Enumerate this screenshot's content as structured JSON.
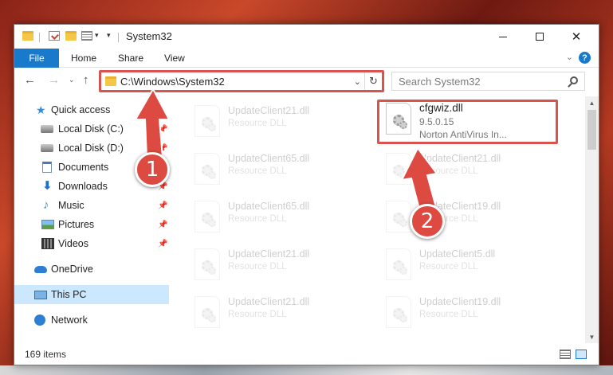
{
  "window": {
    "title": "System32",
    "controls": {
      "minimize": "",
      "maximize": "",
      "close": "✕"
    }
  },
  "ribbon": {
    "file_tab": "File",
    "tabs": [
      "Home",
      "Share",
      "View"
    ],
    "expand_glyph": "⌄",
    "help_glyph": "?"
  },
  "nav": {
    "back": "←",
    "forward": "→",
    "recent": "⌄",
    "up": "↑",
    "address": "C:\\Windows\\System32",
    "address_dropdown": "⌄",
    "refresh": "↻",
    "search_placeholder": "Search System32"
  },
  "sidebar": {
    "items": [
      {
        "label": "Quick access",
        "icon": "star-icon"
      },
      {
        "label": "Local Disk (C:)",
        "icon": "disk-icon",
        "pinned": true
      },
      {
        "label": "Local Disk (D:)",
        "icon": "disk-icon",
        "pinned": true
      },
      {
        "label": "Documents",
        "icon": "documents-icon",
        "pinned": true
      },
      {
        "label": "Downloads",
        "icon": "downloads-icon",
        "pinned": true
      },
      {
        "label": "Music",
        "icon": "music-icon",
        "pinned": true
      },
      {
        "label": "Pictures",
        "icon": "pictures-icon",
        "pinned": true
      },
      {
        "label": "Videos",
        "icon": "videos-icon",
        "pinned": true
      },
      {
        "label": "OneDrive",
        "icon": "onedrive-icon"
      },
      {
        "label": "This PC",
        "icon": "this-pc-icon",
        "selected": true
      },
      {
        "label": "Network",
        "icon": "network-icon"
      }
    ],
    "pin_glyph": "📌"
  },
  "files": {
    "highlighted": {
      "name": "cfgwiz.dll",
      "version": "9.5.0.15",
      "description": "Norton AntiVirus In..."
    },
    "left_column": [
      {
        "name": "UpdateClient21.dll",
        "type": "Resource DLL"
      },
      {
        "name": "UpdateClient65.dll",
        "type": "Resource DLL"
      },
      {
        "name": "UpdateClient65.dll",
        "type": "Resource DLL"
      },
      {
        "name": "UpdateClient21.dll",
        "type": "Resource DLL"
      },
      {
        "name": "UpdateClient21.dll",
        "type": "Resource DLL"
      }
    ],
    "right_column": [
      {
        "name": "UpdateClient21.dll",
        "type": "Resource DLL"
      },
      {
        "name": "UpdateClient19.dll",
        "type": "Resource DLL"
      },
      {
        "name": "UpdateClient5.dll",
        "type": "Resource DLL"
      },
      {
        "name": "UpdateClient19.dll",
        "type": "Resource DLL"
      }
    ]
  },
  "scrollbar": {
    "up": "▲",
    "down": "▼"
  },
  "status": {
    "item_count": "169 items"
  },
  "annotations": {
    "step1": "1",
    "step2": "2",
    "color": "#d9534f"
  }
}
